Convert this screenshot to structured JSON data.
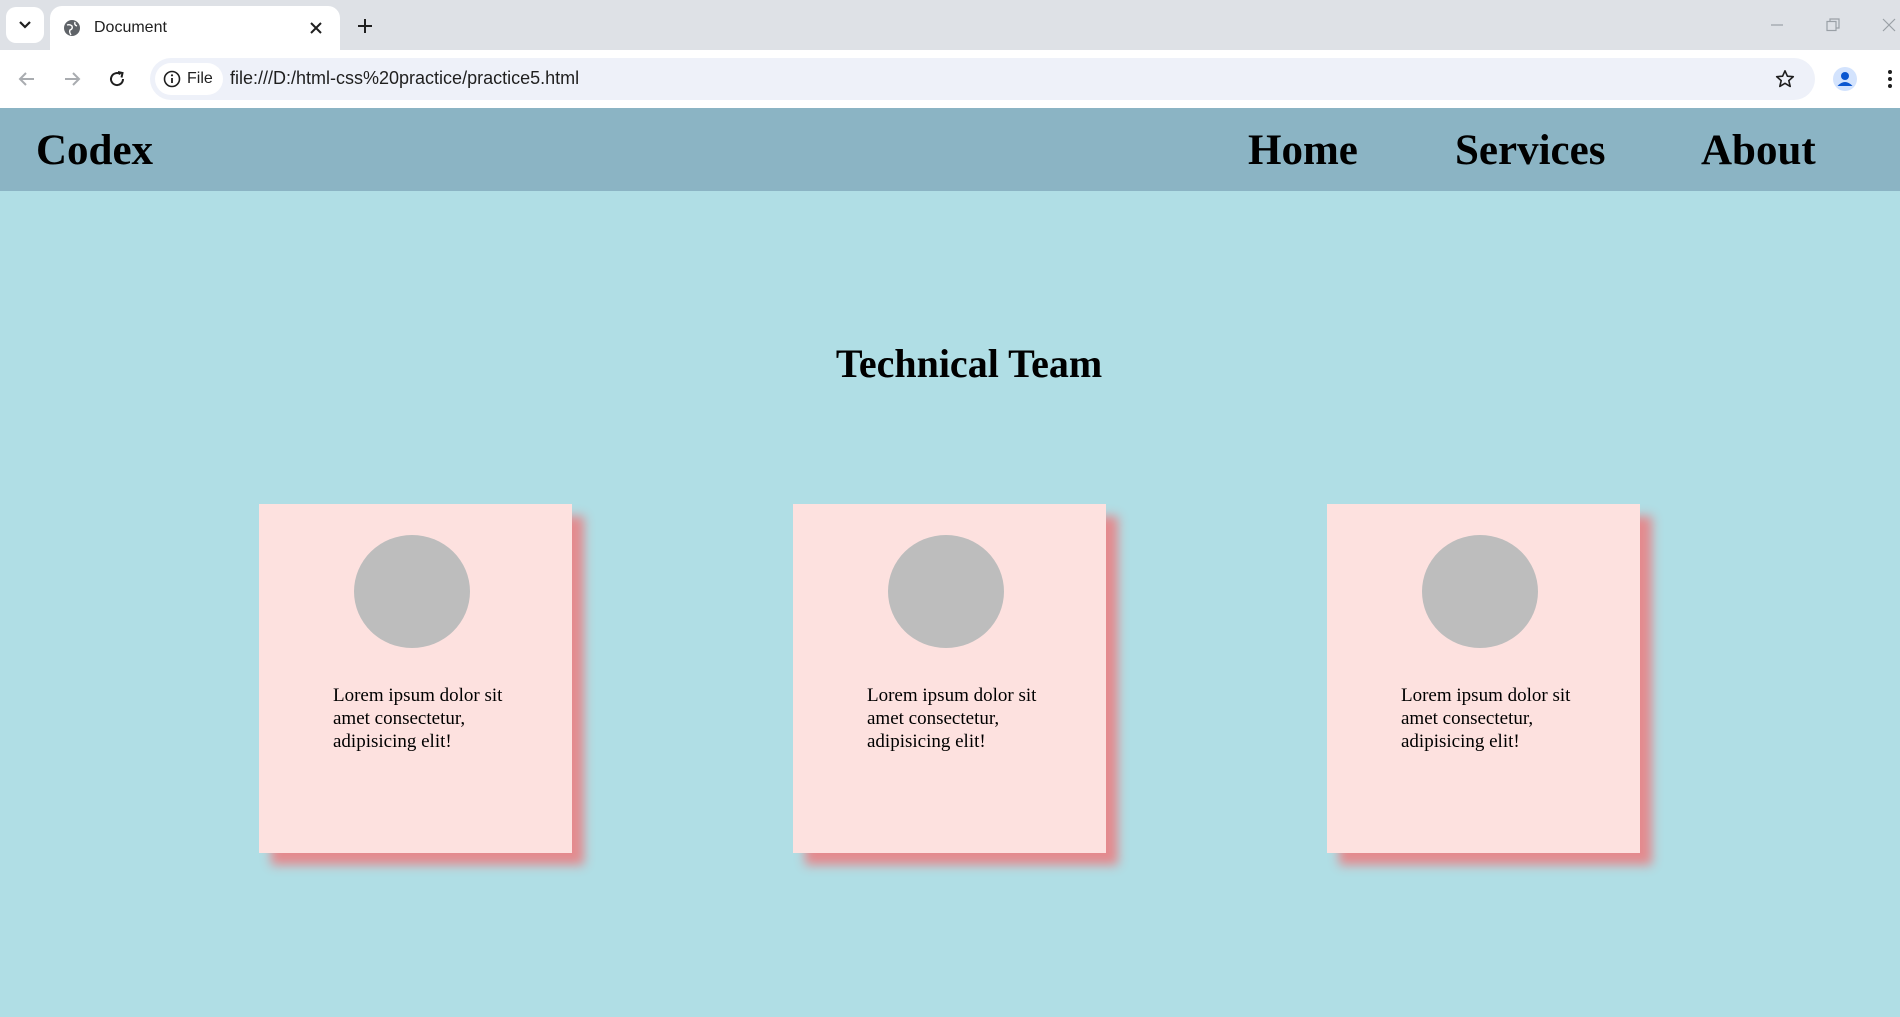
{
  "browser": {
    "tab_title": "Document",
    "site_chip_label": "File",
    "url": "file:///D:/html-css%20practice/practice5.html"
  },
  "site": {
    "logo": "Codex",
    "nav": [
      {
        "label": "Home"
      },
      {
        "label": "Services"
      },
      {
        "label": "About"
      }
    ],
    "section_title": "Technical Team",
    "cards": [
      {
        "text": "Lorem ipsum dolor sit amet consectetur, adipisicing elit!"
      },
      {
        "text": "Lorem ipsum dolor sit amet consectetur, adipisicing elit!"
      },
      {
        "text": "Lorem ipsum dolor sit amet consectetur, adipisicing elit!"
      }
    ]
  },
  "colors": {
    "page_background": "#b0dee5",
    "nav_background": "#8bb4c4",
    "card_background": "#fde1df",
    "card_shadow": "#e48a8e",
    "avatar": "#bdbdbd"
  },
  "icons": {
    "tab_list": "chevron-down-icon",
    "favicon": "globe-icon",
    "tab_close": "close-icon",
    "new_tab": "plus-icon",
    "back": "arrow-left-icon",
    "forward": "arrow-right-icon",
    "reload": "reload-icon",
    "site_info": "info-icon",
    "bookmark": "star-icon",
    "profile": "person-icon",
    "menu": "kebab-icon"
  }
}
